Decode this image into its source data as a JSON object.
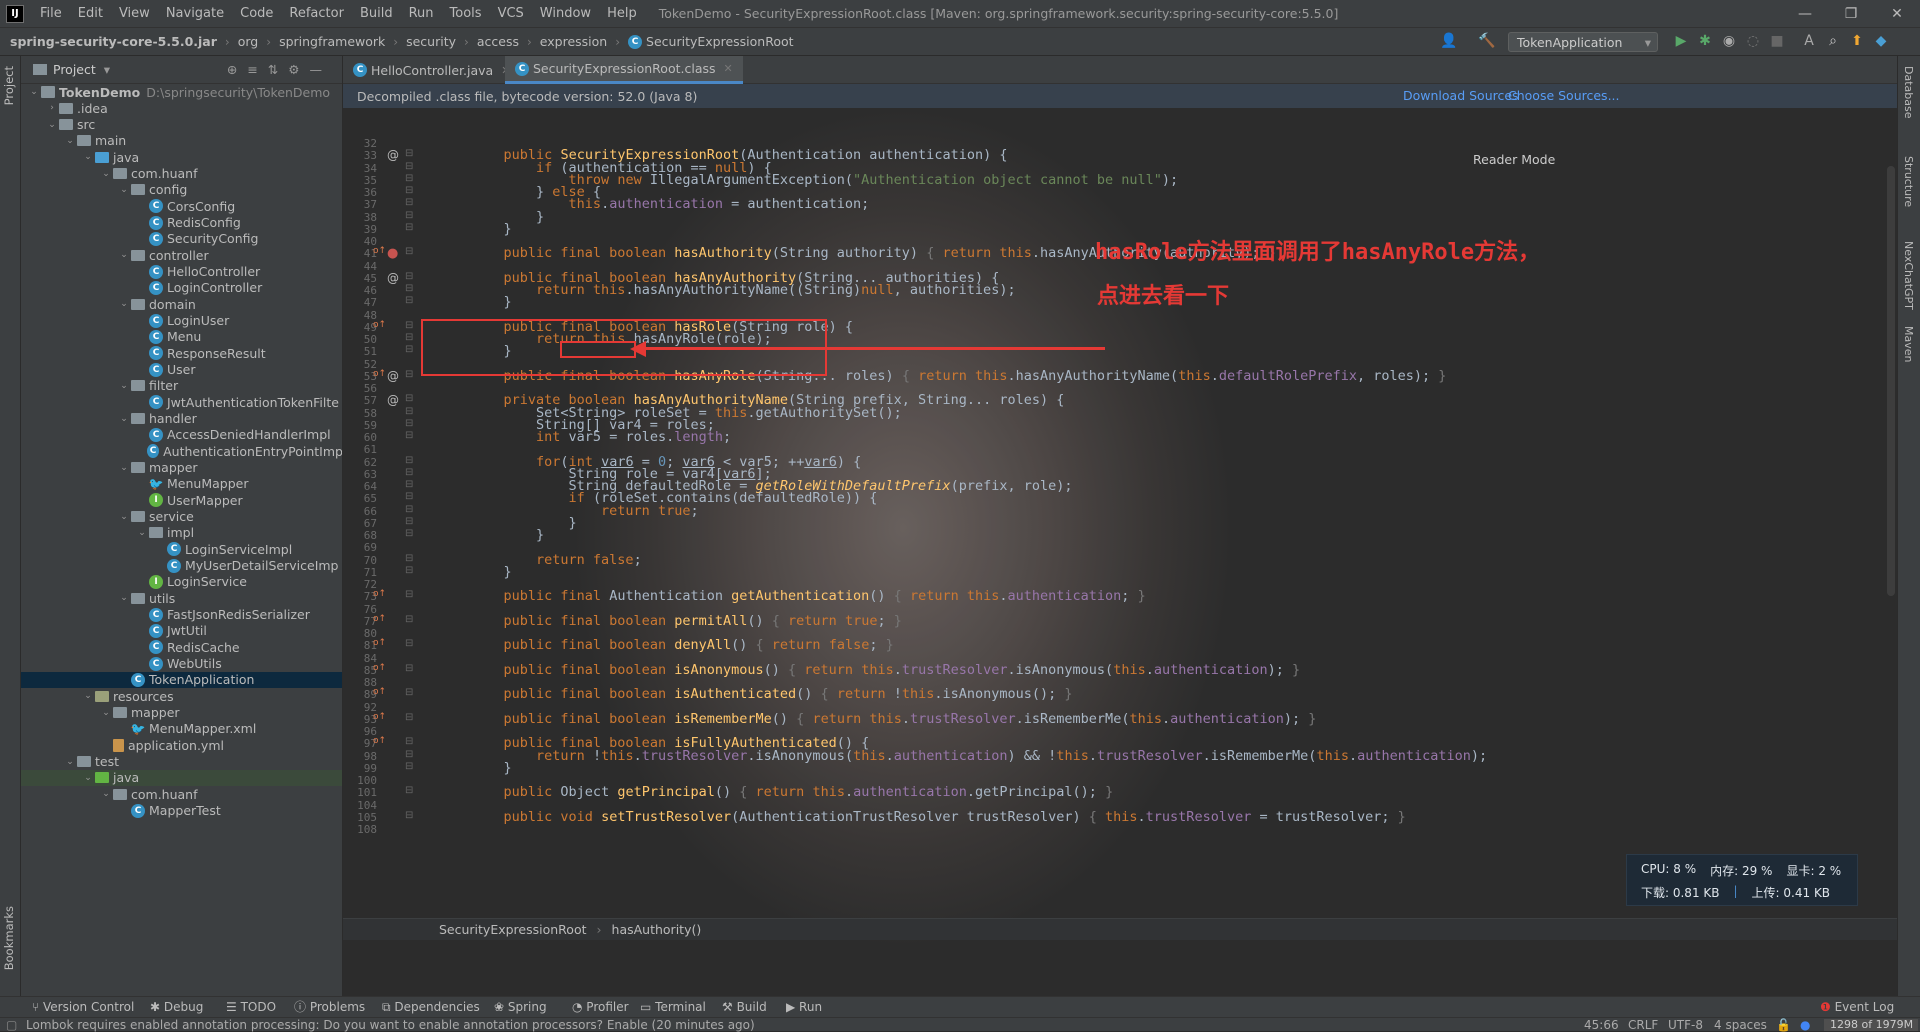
{
  "app": {
    "window_title": "TokenDemo - SecurityExpressionRoot.class [Maven: org.springframework.security:spring-security-core:5.5.0]",
    "menu": [
      "File",
      "Edit",
      "View",
      "Navigate",
      "Code",
      "Refactor",
      "Build",
      "Run",
      "Tools",
      "VCS",
      "Window",
      "Help"
    ],
    "logo": "IJ",
    "win_min": "—",
    "win_max": "❐",
    "win_close": "✕"
  },
  "navbar": {
    "crumbs": [
      "spring-security-core-5.5.0.jar",
      "org",
      "springframework",
      "security",
      "access",
      "expression",
      "SecurityExpressionRoot"
    ],
    "run_config": "TokenApplication"
  },
  "left_strip": {
    "project": "Project",
    "bookmarks": "Bookmarks"
  },
  "right_strip": {
    "database": "Database",
    "structure": "Structure",
    "chatgpt": "NexChatGPT",
    "maven": "Maven"
  },
  "project": {
    "header": "Project",
    "tree": [
      {
        "label": "TokenDemo",
        "path": "D:\\springsecurity\\TokenDemo",
        "kind": "mod",
        "arrow": "⌄",
        "indent": 0,
        "bold": true
      },
      {
        "label": ".idea",
        "kind": "folder",
        "arrow": "›",
        "indent": 1
      },
      {
        "label": "src",
        "kind": "folder",
        "arrow": "⌄",
        "indent": 1
      },
      {
        "label": "main",
        "kind": "folder",
        "arrow": "⌄",
        "indent": 2
      },
      {
        "label": "java",
        "kind": "src",
        "arrow": "⌄",
        "indent": 3
      },
      {
        "label": "com.huanf",
        "kind": "folder",
        "arrow": "⌄",
        "indent": 4
      },
      {
        "label": "config",
        "kind": "folder",
        "arrow": "⌄",
        "indent": 5
      },
      {
        "label": "CorsConfig",
        "kind": "cls",
        "indent": 6
      },
      {
        "label": "RedisConfig",
        "kind": "cls",
        "indent": 6
      },
      {
        "label": "SecurityConfig",
        "kind": "cls",
        "indent": 6
      },
      {
        "label": "controller",
        "kind": "folder",
        "arrow": "⌄",
        "indent": 5
      },
      {
        "label": "HelloController",
        "kind": "cls",
        "indent": 6
      },
      {
        "label": "LoginController",
        "kind": "cls",
        "indent": 6
      },
      {
        "label": "domain",
        "kind": "folder",
        "arrow": "⌄",
        "indent": 5
      },
      {
        "label": "LoginUser",
        "kind": "cls",
        "indent": 6
      },
      {
        "label": "Menu",
        "kind": "cls",
        "indent": 6
      },
      {
        "label": "ResponseResult",
        "kind": "cls",
        "indent": 6
      },
      {
        "label": "User",
        "kind": "cls",
        "indent": 6
      },
      {
        "label": "filter",
        "kind": "folder",
        "arrow": "⌄",
        "indent": 5
      },
      {
        "label": "JwtAuthenticationTokenFilte",
        "kind": "cls",
        "indent": 6
      },
      {
        "label": "handler",
        "kind": "folder",
        "arrow": "⌄",
        "indent": 5
      },
      {
        "label": "AccessDeniedHandlerImpl",
        "kind": "cls",
        "indent": 6
      },
      {
        "label": "AuthenticationEntryPointImp",
        "kind": "cls",
        "indent": 6
      },
      {
        "label": "mapper",
        "kind": "folder",
        "arrow": "⌄",
        "indent": 5
      },
      {
        "label": "MenuMapper",
        "kind": "mapper",
        "indent": 6
      },
      {
        "label": "UserMapper",
        "kind": "intf",
        "indent": 6
      },
      {
        "label": "service",
        "kind": "folder",
        "arrow": "⌄",
        "indent": 5
      },
      {
        "label": "impl",
        "kind": "folder",
        "arrow": "⌄",
        "indent": 6
      },
      {
        "label": "LoginServiceImpl",
        "kind": "cls",
        "indent": 7
      },
      {
        "label": "MyUserDetailServiceImp",
        "kind": "cls",
        "indent": 7
      },
      {
        "label": "LoginService",
        "kind": "intf",
        "indent": 6
      },
      {
        "label": "utils",
        "kind": "folder",
        "arrow": "⌄",
        "indent": 5
      },
      {
        "label": "FastJsonRedisSerializer",
        "kind": "cls",
        "indent": 6
      },
      {
        "label": "JwtUtil",
        "kind": "cls",
        "indent": 6
      },
      {
        "label": "RedisCache",
        "kind": "cls",
        "indent": 6
      },
      {
        "label": "WebUtils",
        "kind": "cls",
        "indent": 6
      },
      {
        "label": "TokenApplication",
        "kind": "cls",
        "indent": 5,
        "selected": true
      },
      {
        "label": "resources",
        "kind": "res",
        "arrow": "⌄",
        "indent": 3
      },
      {
        "label": "mapper",
        "kind": "folder",
        "arrow": "⌄",
        "indent": 4
      },
      {
        "label": "MenuMapper.xml",
        "kind": "mapper",
        "indent": 5
      },
      {
        "label": "application.yml",
        "kind": "file",
        "indent": 4
      },
      {
        "label": "test",
        "kind": "folder",
        "arrow": "⌄",
        "indent": 2
      },
      {
        "label": "java",
        "kind": "tst",
        "arrow": "⌄",
        "indent": 3,
        "test": true
      },
      {
        "label": "com.huanf",
        "kind": "folder",
        "arrow": "⌄",
        "indent": 4
      },
      {
        "label": "MapperTest",
        "kind": "cls",
        "indent": 5
      }
    ]
  },
  "editor": {
    "tabs": [
      {
        "label": "HelloController.java",
        "active": false
      },
      {
        "label": "SecurityExpressionRoot.class",
        "active": true
      }
    ],
    "decompiled_notice": "Decompiled .class file, bytecode version: 52.0 (Java 8)",
    "download_sources": "Download Sources",
    "choose_sources": "Choose Sources...",
    "reader_mode": "Reader Mode",
    "breadcrumb": [
      "SecurityExpressionRoot",
      "hasAuthority()"
    ]
  },
  "code_lines": [
    {
      "n": "32",
      "html": ""
    },
    {
      "n": "33",
      "m": "@",
      "html": "    <span class=kw>public</span> <span class=fn>SecurityExpressionRoot</span>(Authentication authentication) {"
    },
    {
      "n": "34",
      "html": "        <span class=kw>if</span> (authentication == <span class=kw>null</span>) {"
    },
    {
      "n": "35",
      "html": "            <span class=kw>throw new</span> IllegalArgumentException(<span class=str>\"Authentication object cannot be null\"</span>);"
    },
    {
      "n": "36",
      "html": "        } <span class=kw>else</span> {"
    },
    {
      "n": "37",
      "html": "            <span class=kw>this</span>.<span class=fld>authentication</span> = authentication;"
    },
    {
      "n": "38",
      "html": "        }"
    },
    {
      "n": "39",
      "html": "    }"
    },
    {
      "n": "40",
      "html": ""
    },
    {
      "n": "41",
      "m": "bp",
      "html": "    <span class=kw>public final boolean</span> <span class=fn>hasAuthority</span>(String authority) <span class=fold>{</span> <span class=kw>return this</span>.hasAnyAuthority(authority); <span class=fold>}</span>"
    },
    {
      "n": "44",
      "html": ""
    },
    {
      "n": "45",
      "m": "@",
      "html": "    <span class=kw>public final boolean</span> <span class=fn>hasAnyAuthority</span>(String... authorities) {"
    },
    {
      "n": "46",
      "html": "        <span class=kw>return this</span>.hasAnyAuthorityName((String)<span class=kw>null</span>, authorities);"
    },
    {
      "n": "47",
      "html": "    }"
    },
    {
      "n": "48",
      "html": ""
    },
    {
      "n": "49",
      "m": "o",
      "html": "    <span class=kw>public final boolean</span> <span class=fn>hasRole</span>(String role) {"
    },
    {
      "n": "50",
      "html": "        <span class=kw>return this</span>.hasAnyRole(role);"
    },
    {
      "n": "51",
      "html": "    }"
    },
    {
      "n": "52",
      "html": ""
    },
    {
      "n": "53",
      "m": "o@",
      "html": "    <span class=kw>public final boolean</span> <span class=fn>hasAnyRole</span>(String... roles) <span class=fold>{</span> <span class=kw>return this</span>.hasAnyAuthorityName(<span class=kw>this</span>.<span class=fld>defaultRolePrefix</span>, roles); <span class=fold>}</span>"
    },
    {
      "n": "56",
      "html": ""
    },
    {
      "n": "57",
      "m": "@",
      "html": "    <span class=kw>private boolean</span> <span class=fn>hasAnyAuthorityName</span>(String prefix, String... roles) {"
    },
    {
      "n": "58",
      "html": "        Set&lt;String&gt; roleSet = <span class=kw>this</span>.getAuthoritySet();"
    },
    {
      "n": "59",
      "html": "        String[] var4 = roles;"
    },
    {
      "n": "60",
      "html": "        <span class=kw>int</span> var5 = roles.<span class=fld>length</span>;"
    },
    {
      "n": "61",
      "html": ""
    },
    {
      "n": "62",
      "html": "        <span class=kw>for</span>(<span class=kw>int</span> <span class=ul>var6</span> = <span class=num>0</span>; <span class=ul>var6</span> &lt; var5; ++<span class=ul>var6</span>) {"
    },
    {
      "n": "63",
      "html": "            String role = var4[<span class=ul>var6</span>];"
    },
    {
      "n": "64",
      "html": "            String defaultedRole = <span class=it>getRoleWithDefaultPrefix</span>(prefix, role);"
    },
    {
      "n": "65",
      "html": "            <span class=kw>if</span> (roleSet.contains(defaultedRole)) {"
    },
    {
      "n": "66",
      "html": "                <span class=kw>return true</span>;"
    },
    {
      "n": "67",
      "html": "            }"
    },
    {
      "n": "68",
      "html": "        }"
    },
    {
      "n": "69",
      "html": ""
    },
    {
      "n": "70",
      "html": "        <span class=kw>return false</span>;"
    },
    {
      "n": "71",
      "html": "    }"
    },
    {
      "n": "72",
      "html": ""
    },
    {
      "n": "73",
      "m": "o",
      "html": "    <span class=kw>public final</span> Authentication <span class=fn>getAuthentication</span>() <span class=fold>{</span> <span class=kw>return this</span>.<span class=fld>authentication</span>; <span class=fold>}</span>"
    },
    {
      "n": "76",
      "html": ""
    },
    {
      "n": "77",
      "m": "o",
      "html": "    <span class=kw>public final boolean</span> <span class=fn>permitAll</span>() <span class=fold>{</span> <span class=kw>return true</span>; <span class=fold>}</span>"
    },
    {
      "n": "80",
      "html": ""
    },
    {
      "n": "81",
      "m": "o",
      "html": "    <span class=kw>public final boolean</span> <span class=fn>denyAll</span>() <span class=fold>{</span> <span class=kw>return false</span>; <span class=fold>}</span>"
    },
    {
      "n": "84",
      "html": ""
    },
    {
      "n": "85",
      "m": "o",
      "html": "    <span class=kw>public final boolean</span> <span class=fn>isAnonymous</span>() <span class=fold>{</span> <span class=kw>return this</span>.<span class=fld>trustResolver</span>.isAnonymous(<span class=kw>this</span>.<span class=fld>authentication</span>); <span class=fold>}</span>"
    },
    {
      "n": "88",
      "html": ""
    },
    {
      "n": "89",
      "m": "o",
      "html": "    <span class=kw>public final boolean</span> <span class=fn>isAuthenticated</span>() <span class=fold>{</span> <span class=kw>return</span> !<span class=kw>this</span>.isAnonymous(); <span class=fold>}</span>"
    },
    {
      "n": "92",
      "html": ""
    },
    {
      "n": "93",
      "m": "o",
      "html": "    <span class=kw>public final boolean</span> <span class=fn>isRememberMe</span>() <span class=fold>{</span> <span class=kw>return this</span>.<span class=fld>trustResolver</span>.isRememberMe(<span class=kw>this</span>.<span class=fld>authentication</span>); <span class=fold>}</span>"
    },
    {
      "n": "96",
      "html": ""
    },
    {
      "n": "97",
      "m": "o",
      "html": "    <span class=kw>public final boolean</span> <span class=fn>isFullyAuthenticated</span>() {"
    },
    {
      "n": "98",
      "html": "        <span class=kw>return</span> !<span class=kw>this</span>.<span class=fld>trustResolver</span>.isAnonymous(<span class=kw>this</span>.<span class=fld>authentication</span>) &amp;&amp; !<span class=kw>this</span>.<span class=fld>trustResolver</span>.isRememberMe(<span class=kw>this</span>.<span class=fld>authentication</span>);"
    },
    {
      "n": "99",
      "html": "    }"
    },
    {
      "n": "100",
      "html": ""
    },
    {
      "n": "101",
      "html": "    <span class=kw>public</span> Object <span class=fn>getPrincipal</span>() <span class=fold>{</span> <span class=kw>return this</span>.<span class=fld>authentication</span>.getPrincipal(); <span class=fold>}</span>"
    },
    {
      "n": "104",
      "html": ""
    },
    {
      "n": "105",
      "html": "    <span class=kw>public void</span> <span class=fn>setTrustResolver</span>(AuthenticationTrustResolver trustResolver) <span class=fold>{</span> <span class=kw>this</span>.<span class=fld>trustResolver</span> = trustResolver; <span class=fold>}</span>"
    },
    {
      "n": "108",
      "html": ""
    }
  ],
  "annotation": {
    "line1": "hasRole方法里面调用了hasAnyRole方法，",
    "line2": "点进去看一下",
    "color": "#e53935"
  },
  "sysmon": {
    "cpu": "CPU: 8 %",
    "mem": "内存: 29 %",
    "gpu": "显卡: 2 %",
    "down": "下载: 0.81 KB",
    "up": "上传: 0.41 KB"
  },
  "bottom_tools": [
    "Version Control",
    "Debug",
    "TODO",
    "Problems",
    "Dependencies",
    "Spring",
    "Profiler",
    "Terminal",
    "Build",
    "Run"
  ],
  "event_log": "Event Log",
  "status": {
    "message": "Lombok requires enabled annotation processing: Do you want to enable annotation processors? Enable (20 minutes ago)",
    "position": "45:66",
    "line_sep": "CRLF",
    "encoding": "UTF-8",
    "indent": "4 spaces",
    "memory": "1298 of 1979M"
  }
}
